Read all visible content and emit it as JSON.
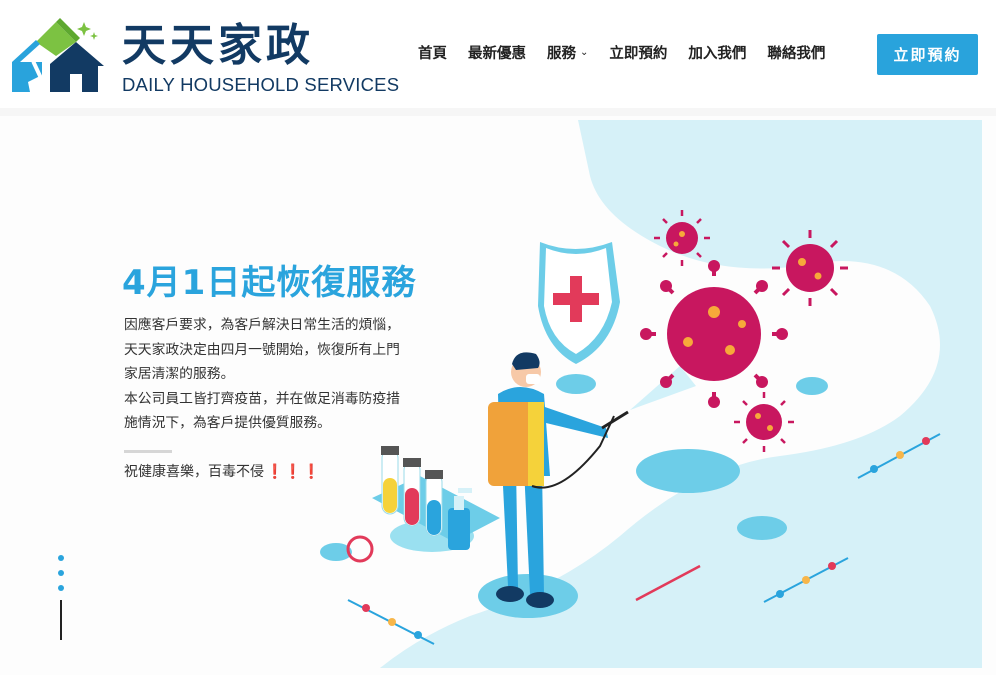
{
  "header": {
    "logo_cn": "天天家政",
    "logo_en": "DAILY HOUSEHOLD SERVICES",
    "nav": [
      {
        "label": "首頁"
      },
      {
        "label": "最新優惠"
      },
      {
        "label": "服務"
      },
      {
        "label": "立即預約"
      },
      {
        "label": "加入我們"
      },
      {
        "label": "聯絡我們"
      }
    ],
    "cta_label": "立即預約"
  },
  "hero": {
    "title": "4月1日起恢復服務",
    "paragraph": [
      "因應客戶要求，為客戶解決日常生活的煩惱，",
      "天天家政決定由四月一號開始，恢復所有上門",
      "家居清潔的服務。",
      "本公司員工皆打齊疫苗，并在做足消毒防疫措",
      "施情況下，為客戶提供優質服務。"
    ],
    "slogan": "祝健康喜樂，百毒不侵",
    "slogan_marks": "❗❗❗"
  },
  "colors": {
    "brand_blue": "#2aa4dd",
    "logo_navy": "#123a63",
    "logo_green": "#7cc242",
    "virus_magenta": "#c8175f",
    "bg_light_blue": "#d6f1f8"
  },
  "slider": {
    "active_index": 1,
    "count": 3
  }
}
